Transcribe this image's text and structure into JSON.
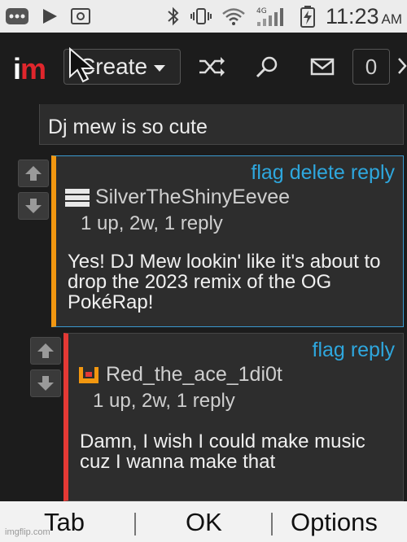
{
  "status_bar": {
    "time": "11:23",
    "ampm": "AM",
    "icons": [
      "more-dots-icon",
      "play-icon",
      "notification-icon",
      "bluetooth-icon",
      "vibrate-icon",
      "wifi-icon",
      "signal-icon",
      "battery-charging-icon"
    ],
    "signal_label": "4G"
  },
  "app_bar": {
    "logo_i": "i",
    "logo_m": "m",
    "create_label": "Create",
    "icons": [
      "shuffle-icon",
      "search-icon",
      "mail-icon"
    ],
    "notification_count": "0"
  },
  "comments": [
    {
      "body": "Dj mew is so cute"
    },
    {
      "actions": [
        "flag",
        "delete",
        "reply"
      ],
      "username": "SilverTheShinyEevee",
      "meta": "1 up, 2w, 1 reply",
      "body": "Yes! DJ Mew lookin' like it's about to drop the 2023 remix of the OG PokéRap!",
      "accent": "#f29710"
    },
    {
      "actions": [
        "flag",
        "reply"
      ],
      "username": "Red_the_ace_1di0t",
      "meta": "1 up, 2w, 1 reply",
      "body": "Damn, I wish I could make music cuz I wanna make that",
      "accent": "#e53935"
    }
  ],
  "softkeys": {
    "left": "Tab",
    "center": "OK",
    "right": "Options"
  },
  "watermark": "imgflip.com",
  "colors": {
    "link": "#2ea7de",
    "brand_red": "#e0262c"
  }
}
